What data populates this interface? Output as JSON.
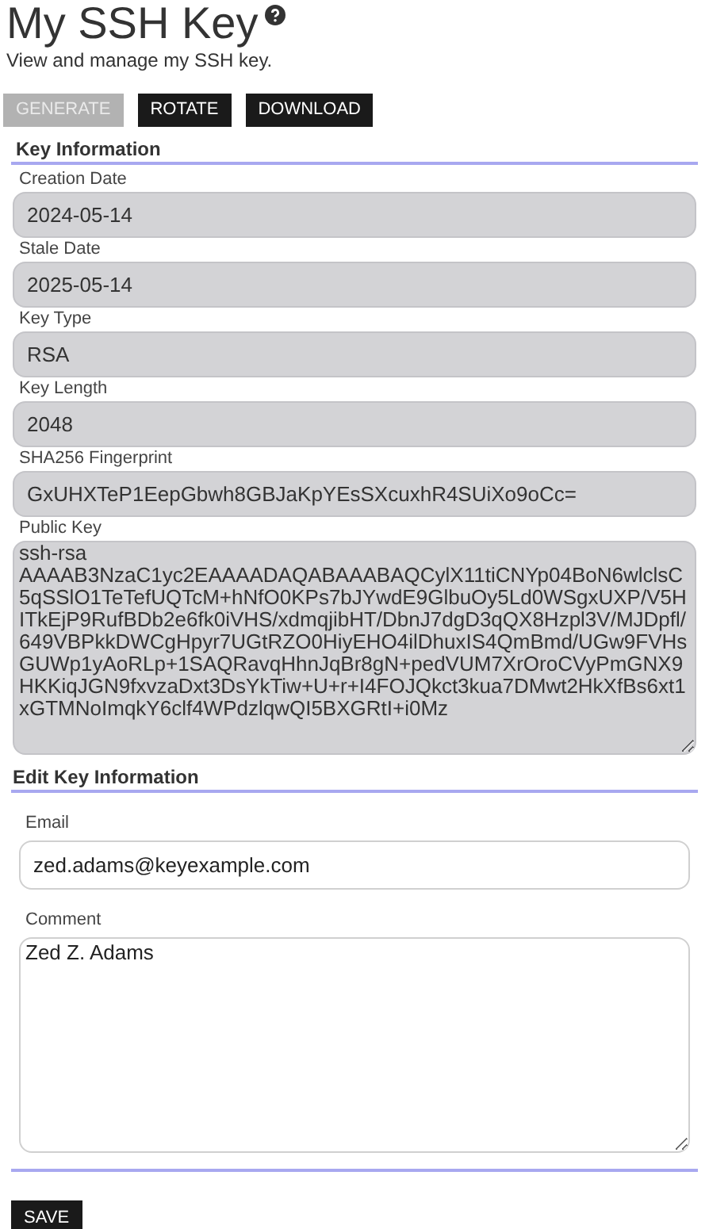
{
  "page": {
    "title": "My SSH Key",
    "subtitle": "View and manage my SSH key."
  },
  "actions": [
    {
      "label": "GENERATE",
      "disabled": true
    },
    {
      "label": "ROTATE",
      "disabled": false
    },
    {
      "label": "DOWNLOAD",
      "disabled": false
    }
  ],
  "key_information": {
    "heading": "Key Information",
    "fields": [
      {
        "label": "Creation Date",
        "value": "2024-05-14",
        "kind": "line"
      },
      {
        "label": "Stale Date",
        "value": "2025-05-14",
        "kind": "line"
      },
      {
        "label": "Key Type",
        "value": "RSA",
        "kind": "line"
      },
      {
        "label": "Key Length",
        "value": "2048",
        "kind": "line"
      },
      {
        "label": "SHA256 Fingerprint",
        "value": "GxUHXTeP1EepGbwh8GBJaKpYEsSXcuxhR4SUiXo9oCc=",
        "kind": "line"
      },
      {
        "label": "Public Key",
        "value": "ssh-rsa AAAAB3NzaC1yc2EAAAADAQABAAABAQCylX11tiCNYp04BoN6wlclsC5qSSlO1TeTefUQTcM+hNfO0KPs7bJYwdE9GlbuOy5Ld0WSgxUXP/V5HITkEjP9RufBDb2e6fk0iVHS/xdmqjibHT/DbnJ7dgD3qQX8Hzpl3V/MJDpfl/649VBPkkDWCgHpyr7UGtRZO0HiyEHO4ilDhuxIS4QmBmd/UGw9FVHsGUWp1yAoRLp+1SAQRavqHhnJqBr8gN+pedVUM7XrOroCVyPmGNX9HKKiqJGN9fxvzaDxt3DsYkTiw+U+r+I4FOJQkct3kua7DMwt2HkXfBs6xt1xGTMNoImqkY6clf4WPdzlqwQI5BXGRtI+i0Mz",
        "kind": "area"
      }
    ]
  },
  "edit_key_information": {
    "heading": "Edit Key Information",
    "fields": [
      {
        "label": "Email",
        "value": "zed.adams@keyexample.com",
        "kind": "line"
      },
      {
        "label": "Comment",
        "value": "Zed Z. Adams",
        "kind": "area"
      }
    ]
  },
  "save_button": {
    "label": "SAVE"
  }
}
